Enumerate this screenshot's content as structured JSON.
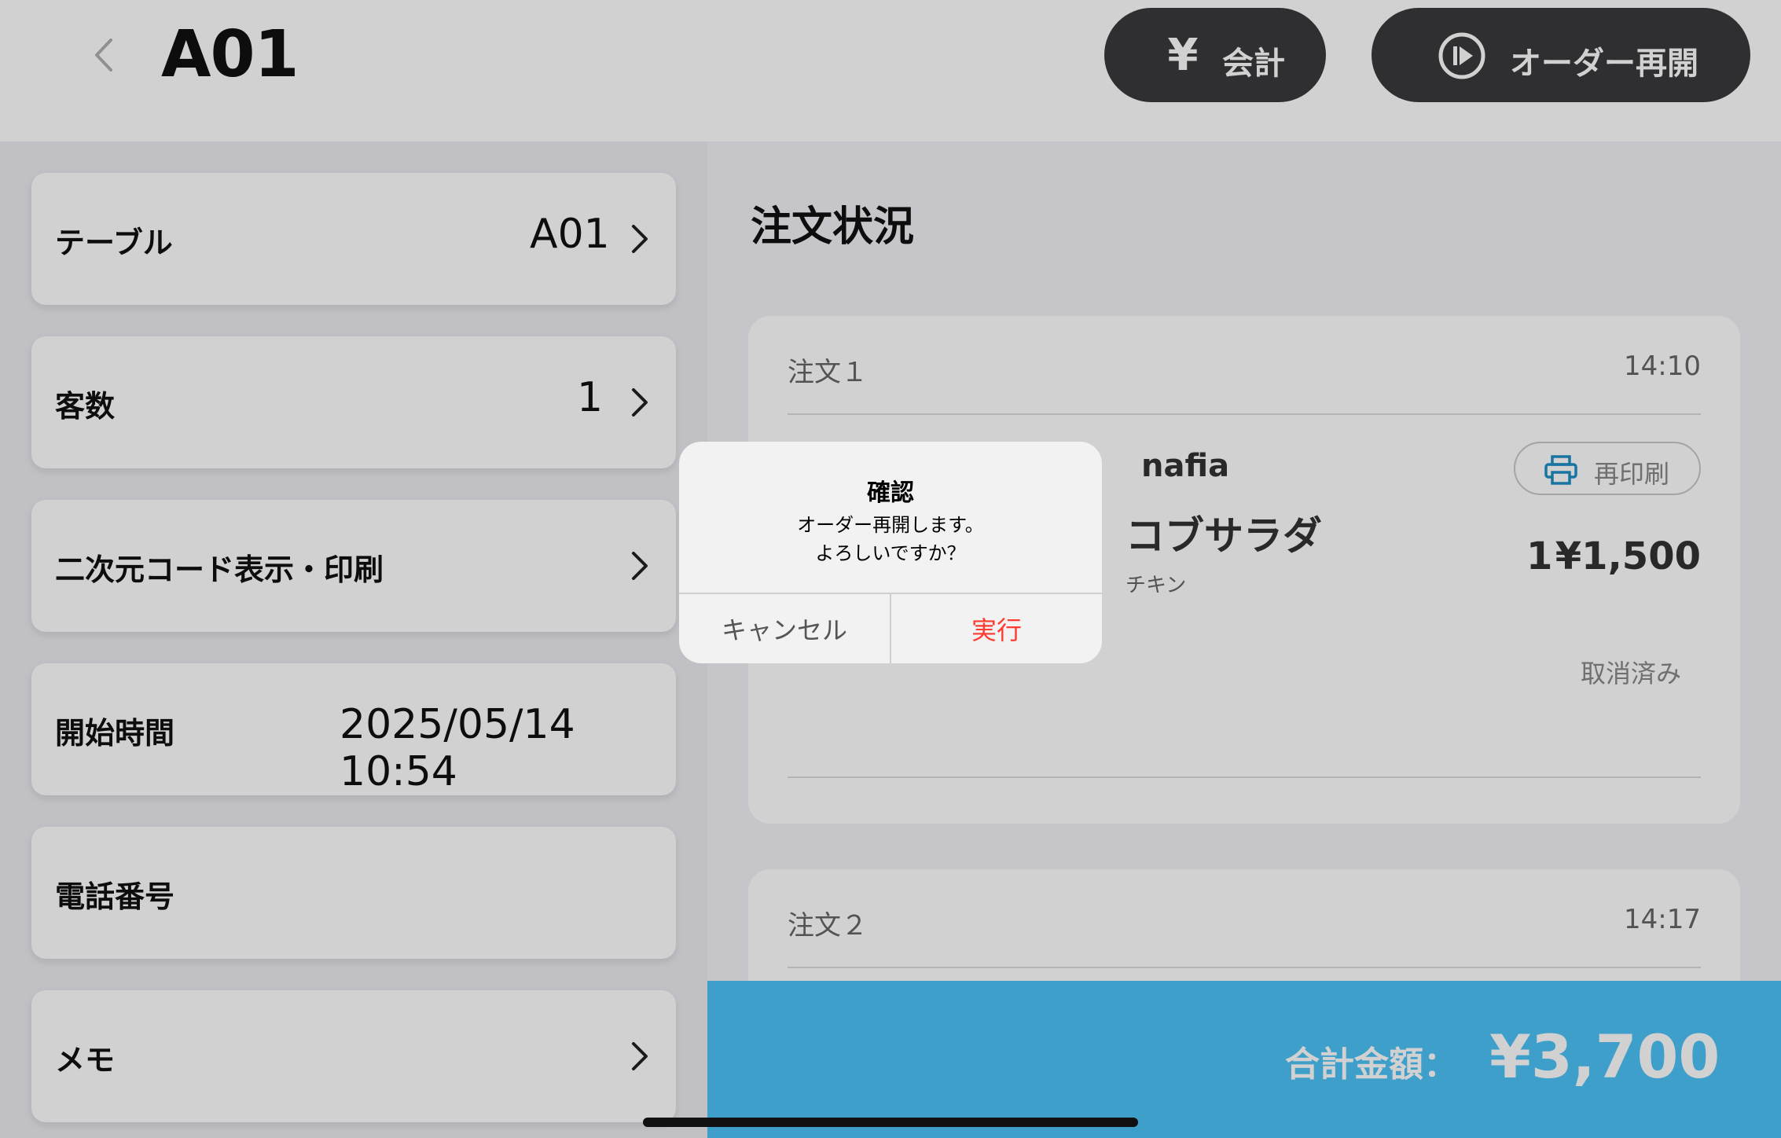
{
  "header": {
    "title": "A01",
    "pay_button": {
      "icon": "yen-icon",
      "icon_text": "¥",
      "label": "会計"
    },
    "resume_button": {
      "icon": "play-circle-icon",
      "label": "オーダー再開"
    }
  },
  "left": {
    "table": {
      "label": "テーブル",
      "value": "A01"
    },
    "guests": {
      "label": "客数",
      "value": "1"
    },
    "qr": {
      "label": "二次元コード表示・印刷"
    },
    "start_time": {
      "label": "開始時間",
      "value": "2025/05/14 10:54"
    },
    "phone": {
      "label": "電話番号",
      "value": ""
    },
    "memo": {
      "label": "メモ"
    }
  },
  "orders": {
    "section_title": "注文状況",
    "list": [
      {
        "label": "注文１",
        "time": "14:10",
        "shop": "nafia",
        "reprint_label": "再印刷",
        "item_name": "コブサラダ",
        "item_option": "チキン",
        "qty": "1",
        "price": "¥1,500",
        "status": "取消済み"
      },
      {
        "label": "注文２",
        "time": "14:17"
      }
    ]
  },
  "footer": {
    "total_label": "合計金額：",
    "total_value": "¥3,700"
  },
  "dialog": {
    "title": "確認",
    "message_line1": "オーダー再開します。",
    "message_line2": "よろしいですか？",
    "cancel_label": "キャンセル",
    "confirm_label": "実行"
  },
  "colors": {
    "accent": "#4cc3f7",
    "destructive": "#ff3b30",
    "dark_button": "#3a3a3c"
  }
}
